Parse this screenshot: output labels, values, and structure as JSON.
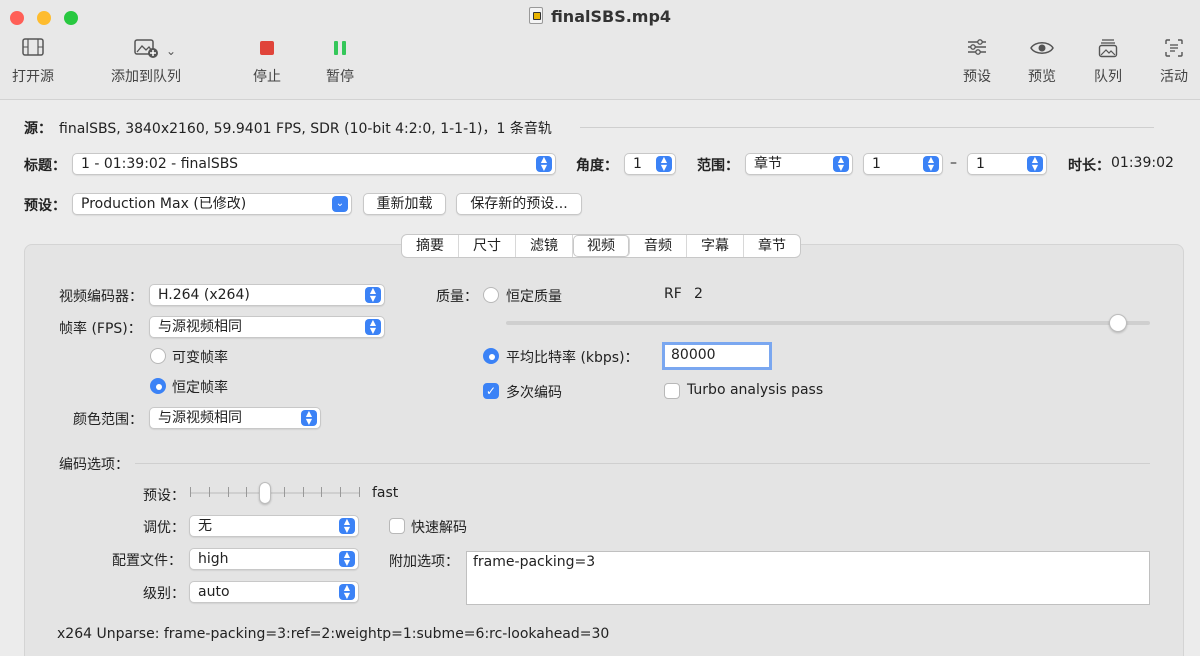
{
  "window": {
    "title": "finalSBS.mp4"
  },
  "toolbar": {
    "open_source": "打开源",
    "add_to_queue": "添加到队列",
    "stop": "停止",
    "pause": "暂停",
    "presets": "预设",
    "preview": "预览",
    "queue": "队列",
    "activity": "活动"
  },
  "source": {
    "label": "源：",
    "info": "finalSBS, 3840x2160, 59.9401 FPS, SDR (10-bit 4:2:0, 1-1-1)，1 条音轨"
  },
  "title_row": {
    "title_label": "标题：",
    "title_value": "1 - 01:39:02 - finalSBS",
    "angle_label": "角度：",
    "angle_value": "1",
    "range_label": "范围：",
    "range_type": "章节",
    "range_from": "1",
    "range_dash": "–",
    "range_to": "1",
    "duration_label": "时长：",
    "duration_value": "01:39:02"
  },
  "preset_row": {
    "label": "预设：",
    "value": "Production Max (已修改)",
    "reload": "重新加载",
    "save_new": "保存新的预设..."
  },
  "tabs": [
    "摘要",
    "尺寸",
    "滤镜",
    "视频",
    "音频",
    "字幕",
    "章节"
  ],
  "selected_tab": "视频",
  "video": {
    "encoder_label": "视频编码器：",
    "encoder_value": "H.264 (x264)",
    "fps_label": "帧率 (FPS)：",
    "fps_value": "与源视频相同",
    "variable_fps": "可变帧率",
    "constant_fps": "恒定帧率",
    "color_range_label": "颜色范围：",
    "color_range_value": "与源视频相同",
    "quality_label": "质量：",
    "constant_quality": "恒定质量",
    "rf_label": "RF",
    "rf_value": "2",
    "avg_bitrate_label": "平均比特率 (kbps)：",
    "avg_bitrate_value": "80000",
    "multipass": "多次编码",
    "turbo": "Turbo analysis pass",
    "rf_slider_position": 0.95
  },
  "encoder_options": {
    "section_label": "编码选项：",
    "preset_label": "预设：",
    "preset_value": "fast",
    "tune_label": "调优：",
    "tune_value": "无",
    "fast_decode": "快速解码",
    "profile_label": "配置文件：",
    "profile_value": "high",
    "extra_label": "附加选项：",
    "extra_value": "frame-packing=3",
    "level_label": "级别：",
    "level_value": "auto",
    "unparse": "x264 Unparse: frame-packing=3:ref=2:weightp=1:subme=6:rc-lookahead=30"
  },
  "colors": {
    "accent": "#3b82f6",
    "stop": "#e0443a",
    "pause": "#34c759"
  }
}
